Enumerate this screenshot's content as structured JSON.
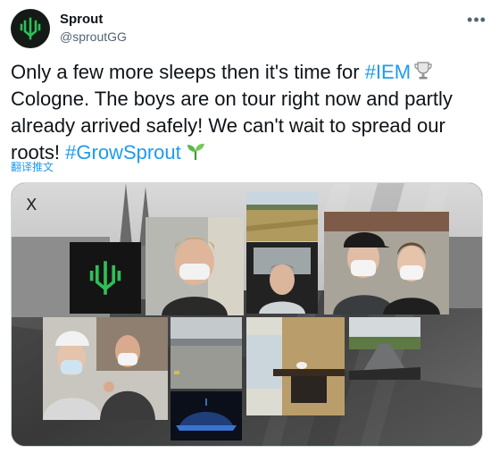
{
  "tweet": {
    "author_name": "Sprout",
    "author_handle": "@sproutGG",
    "text_part1": "Only a few more sleeps then it's time for ",
    "hashtag_iem": "#IEM",
    "text_part2": "Cologne. The boys are on tour right now and partly already arrived safely! We can't wait to spread our roots! ",
    "hashtag_growsprout": "#GrowSprout",
    "translate_label": "翻译推文"
  },
  "icons": {
    "more": "more-options-icon",
    "trophy": "trophy-emoji",
    "seedling": "seedling-emoji",
    "close": "close-icon"
  },
  "media": {
    "close_glyph": "X"
  },
  "colors": {
    "link": "#1d9bf0",
    "text": "#0f1419",
    "secondary": "#536471",
    "brand_green": "#2fbf57"
  }
}
